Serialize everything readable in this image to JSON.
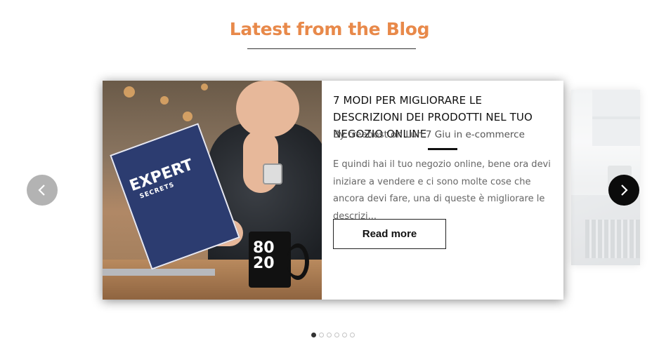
{
  "section": {
    "title": "Latest from the Blog"
  },
  "post": {
    "title": "7 MODI PER MIGLIORARE LE DESCRIZIONI DEI PRODOTTI NEL TUO NEGOZIO ONLINE",
    "meta": "By treehost on Lun 7 Giu in e-commerce",
    "excerpt": "E quindi hai il tuo negozio online, bene ora devi iniziare a vendere e ci sono molte cose che ancora devi fare, una di queste è migliorare le descrizi...",
    "read_more_label": "Read more",
    "image": {
      "book_title": "EXPERT",
      "book_subtitle": "SECRETS",
      "mug_text": "80\n20"
    }
  },
  "carousel": {
    "prev_icon": "chevron-left-icon",
    "next_icon": "chevron-right-icon",
    "dots": [
      true,
      false,
      false,
      false,
      false,
      false
    ]
  },
  "colors": {
    "title": "#e8894a",
    "prev_button": "#b3b3b3",
    "next_button": "#0b0b0b"
  }
}
